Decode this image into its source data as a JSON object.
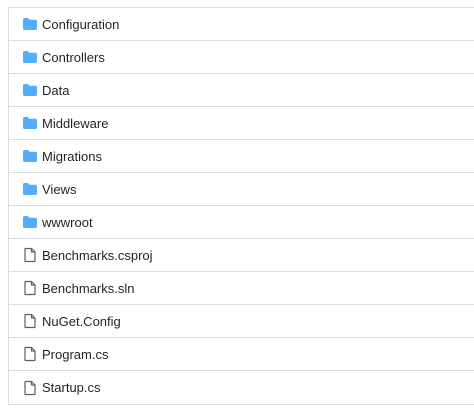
{
  "colors": {
    "folder_icon": "#54aeff",
    "file_icon": "#57606a",
    "text": "#1f2328",
    "border": "#d8dee4"
  },
  "file_list": {
    "items": [
      {
        "name": "Configuration",
        "type": "folder",
        "icon": "folder-icon"
      },
      {
        "name": "Controllers",
        "type": "folder",
        "icon": "folder-icon"
      },
      {
        "name": "Data",
        "type": "folder",
        "icon": "folder-icon"
      },
      {
        "name": "Middleware",
        "type": "folder",
        "icon": "folder-icon"
      },
      {
        "name": "Migrations",
        "type": "folder",
        "icon": "folder-icon"
      },
      {
        "name": "Views",
        "type": "folder",
        "icon": "folder-icon"
      },
      {
        "name": "wwwroot",
        "type": "folder",
        "icon": "folder-icon"
      },
      {
        "name": "Benchmarks.csproj",
        "type": "file",
        "icon": "file-icon"
      },
      {
        "name": "Benchmarks.sln",
        "type": "file",
        "icon": "file-icon"
      },
      {
        "name": "NuGet.Config",
        "type": "file",
        "icon": "file-icon"
      },
      {
        "name": "Program.cs",
        "type": "file",
        "icon": "file-icon"
      },
      {
        "name": "Startup.cs",
        "type": "file",
        "icon": "file-icon"
      }
    ]
  }
}
